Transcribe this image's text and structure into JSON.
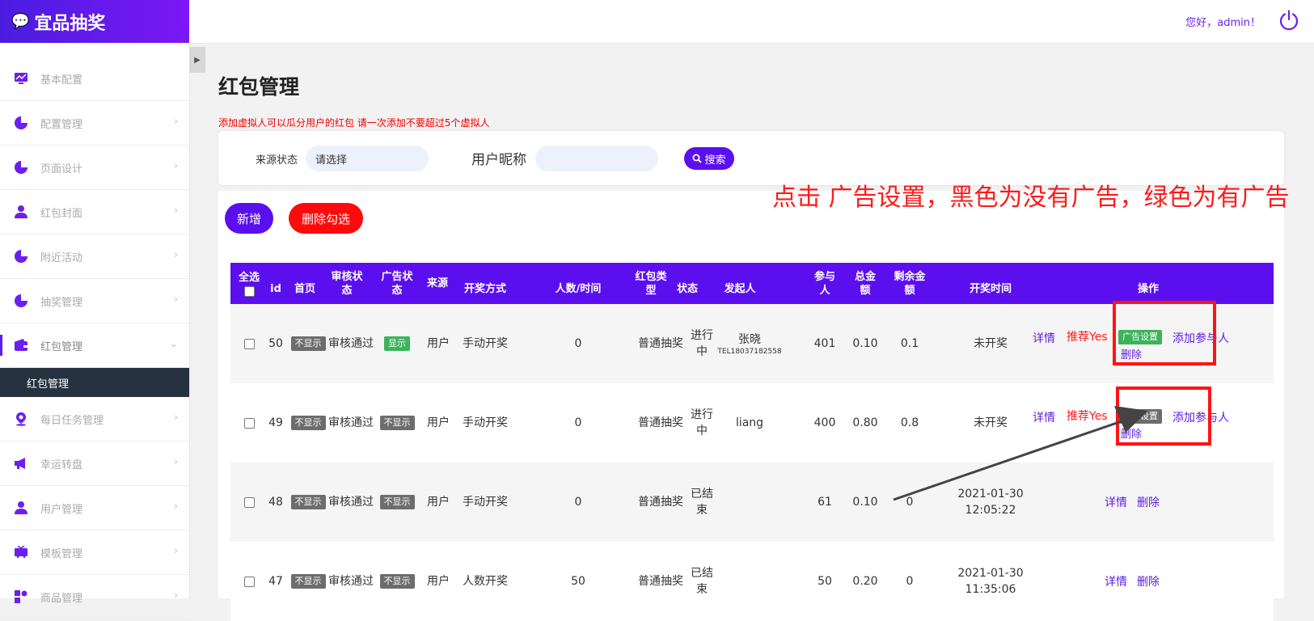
{
  "app": {
    "logo": "宜品抽奖"
  },
  "header": {
    "greeting": "您好，admin！"
  },
  "sidebar": {
    "items": [
      {
        "label": "基本配置",
        "icon": "chart-monitor-icon"
      },
      {
        "label": "配置管理",
        "icon": "pie-chart-icon"
      },
      {
        "label": "页面设计",
        "icon": "pie-chart-icon"
      },
      {
        "label": "红包封面",
        "icon": "user-icon"
      },
      {
        "label": "附近活动",
        "icon": "pie-chart-icon"
      },
      {
        "label": "抽奖管理",
        "icon": "pie-chart-icon"
      },
      {
        "label": "红包管理",
        "icon": "wallet-icon"
      },
      {
        "label": "每日任务管理",
        "icon": "location-user-icon"
      },
      {
        "label": "幸运转盘",
        "icon": "megaphone-icon"
      },
      {
        "label": "用户管理",
        "icon": "user-icon"
      },
      {
        "label": "模板管理",
        "icon": "tv-icon"
      },
      {
        "label": "商品管理",
        "icon": "shapes-icon"
      }
    ],
    "active_sub": "红包管理"
  },
  "page": {
    "title": "红包管理",
    "warning": "添加虚拟人可以瓜分用户的红包 请一次添加不要超过5个虚拟人",
    "annotation": "点击 广告设置，黑色为没有广告，绿色为有广告"
  },
  "search": {
    "source_label": "来源状态",
    "source_value": "请选择",
    "nick_label": "用户昵称",
    "nick_value": "",
    "search_button": "搜索"
  },
  "actions": {
    "add": "新增",
    "delete_selected": "删除勾选"
  },
  "table": {
    "headers": {
      "select_all": "全选",
      "id": "id",
      "home": "首页",
      "review": "审核状态",
      "ad": "广告状态",
      "source": "来源",
      "draw_method": "开奖方式",
      "people_time": "人数/时间",
      "type": "红包类型",
      "status": "状态",
      "initiator": "发起人",
      "participants": "参与人",
      "total": "总金额",
      "remain": "剩余金额",
      "draw_time": "开奖时间",
      "ops": "操作"
    },
    "rows": [
      {
        "id": "50",
        "home": "不显示",
        "review": "审核通过",
        "ad": "显示",
        "source": "用户",
        "method": "手动开奖",
        "people_time": "0",
        "type": "普通抽奖",
        "status": "进行中",
        "initiator": "张晓",
        "initiator_tel": "TEL18037182558",
        "participants": "401",
        "total": "0.10",
        "remain": "0.1",
        "draw_time": "未开奖",
        "op_detail": "详情",
        "op_recommend": "推荐Yes",
        "op_ad": "广告设置",
        "op_add": "添加参与人",
        "op_delete": "删除"
      },
      {
        "id": "49",
        "home": "不显示",
        "review": "审核通过",
        "ad": "不显示",
        "source": "用户",
        "method": "手动开奖",
        "people_time": "0",
        "type": "普通抽奖",
        "status": "进行中",
        "initiator": "liang",
        "participants": "400",
        "total": "0.80",
        "remain": "0.8",
        "draw_time": "未开奖",
        "op_detail": "详情",
        "op_recommend": "推荐Yes",
        "op_ad": "广告设置",
        "op_add": "添加参与人",
        "op_delete": "删除"
      },
      {
        "id": "48",
        "home": "不显示",
        "review": "审核通过",
        "ad": "不显示",
        "source": "用户",
        "method": "手动开奖",
        "people_time": "0",
        "type": "普通抽奖",
        "status": "已结束",
        "initiator": "",
        "participants": "61",
        "total": "0.10",
        "remain": "0",
        "draw_time": "2021-01-30 12:05:22",
        "op_detail": "详情",
        "op_delete": "删除"
      },
      {
        "id": "47",
        "home": "不显示",
        "review": "审核通过",
        "ad": "不显示",
        "source": "用户",
        "method": "人数开奖",
        "people_time": "50",
        "type": "普通抽奖",
        "status": "已结束",
        "initiator": "",
        "participants": "50",
        "total": "0.20",
        "remain": "0",
        "draw_time": "2021-01-30 11:35:06",
        "op_detail": "详情",
        "op_delete": "删除"
      }
    ]
  },
  "colors": {
    "brand": "#5b0fef",
    "danger": "#ff0a0a",
    "tag_gray": "#6d6d6d",
    "tag_green": "#3cb35a"
  }
}
